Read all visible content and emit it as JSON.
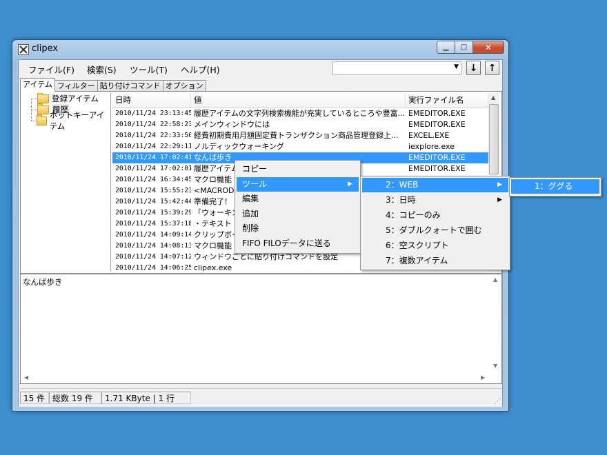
{
  "window": {
    "title": "clipex"
  },
  "caption_buttons": {
    "minimize": "▁",
    "maximize": "□",
    "close": "✕"
  },
  "menubar": [
    "ファイル(F)",
    "検索(S)",
    "ツール(T)",
    "ヘルプ(H)"
  ],
  "search": {
    "value": "",
    "placeholder": ""
  },
  "toolbar": {
    "down_label": "↓",
    "up_label": "↑"
  },
  "tabs": [
    "アイテム",
    "フィルター",
    "貼り付けコマンド",
    "オプション"
  ],
  "tree": [
    "登録アイテム",
    "履歴",
    "ホットキーアイテム"
  ],
  "list": {
    "headers": [
      "日時",
      "値",
      "実行ファイル名"
    ],
    "rows": [
      [
        "2010/11/24 23:13:45",
        "履歴アイテムの文字列検索機能が充実しているところや豊富...",
        "EMEDITOR.EXE"
      ],
      [
        "2010/11/24 22:58:23",
        "メインウィンドウには",
        "EMEDITOR.EXE"
      ],
      [
        "2010/11/24 22:33:56",
        "経費初期費用月額固定費トランザクション商品管理登録上...",
        "EXCEL.EXE"
      ],
      [
        "2010/11/24 22:29:11",
        "ノルディックウォーキング",
        "iexplore.exe"
      ],
      [
        "2010/11/24 17:02:41",
        "なんば歩き",
        "EMEDITOR.EXE"
      ],
      [
        "2010/11/24 17:02:01",
        "履歴アイテム",
        "EMEDITOR.EXE"
      ],
      [
        "2010/11/24 16:34:45",
        "マクロ機能",
        ""
      ],
      [
        "2010/11/24 15:55:23",
        "<MACROD",
        ""
      ],
      [
        "2010/11/24 15:42:44",
        "準備完了！",
        ""
      ],
      [
        "2010/11/24 15:39:29",
        "「ウォーキン",
        ""
      ],
      [
        "2010/11/24 15:37:18",
        "・テキスト・画",
        ""
      ],
      [
        "2010/11/24 14:09:14",
        "クリップボード",
        ""
      ],
      [
        "2010/11/24 14:08:13",
        "マクロ機能",
        ""
      ],
      [
        "2010/11/24 14:07:12",
        "ウィンドウごとに貼り付けコマンドを設定",
        ""
      ],
      [
        "2010/11/24 14:06:25",
        "clipex.exe",
        ""
      ]
    ]
  },
  "detail_text": "なんば歩き",
  "status": [
    "15 件",
    "総数 19 件",
    "1.71 KByte | 1 行"
  ],
  "context_menu": [
    "コピー",
    "ツール",
    "編集",
    "追加",
    "削除",
    "FIFO FILOデータに送る"
  ],
  "submenu": [
    "2：WEB",
    "3：日時",
    "4：コピーのみ",
    "5：ダブルクォートで囲む",
    "6：空スクリプト",
    "7：複数アイテム"
  ],
  "submenu2": [
    "1：ググる"
  ],
  "colors": {
    "desktop": "#3f8fcf",
    "highlight": "#3399ff",
    "close_button": "#c75132"
  }
}
